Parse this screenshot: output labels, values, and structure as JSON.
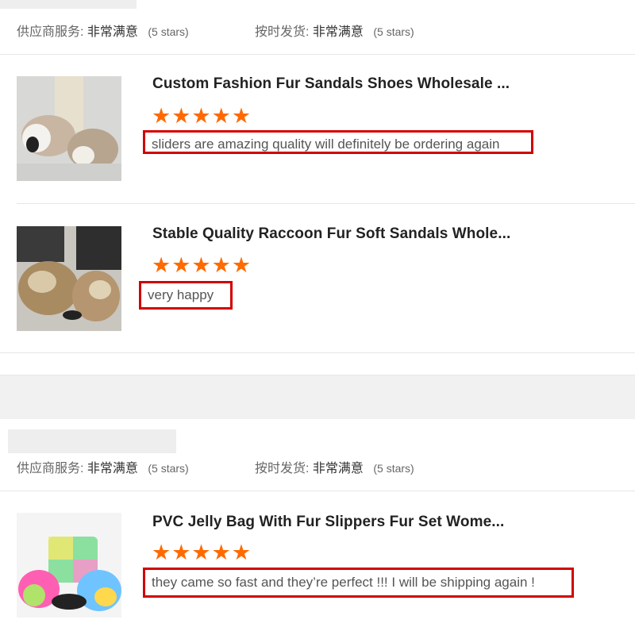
{
  "groups": [
    {
      "supplier_service_label": "供应商服务:",
      "supplier_service_value": "非常满意",
      "supplier_service_stars": "(5 stars)",
      "shipping_label": "按时发货:",
      "shipping_value": "非常满意",
      "shipping_stars": "(5 stars)"
    },
    {
      "supplier_service_label": "供应商服务:",
      "supplier_service_value": "非常满意",
      "supplier_service_stars": "(5 stars)",
      "shipping_label": "按时发货:",
      "shipping_value": "非常满意",
      "shipping_stars": "(5 stars)"
    }
  ],
  "reviews": [
    {
      "title": "Custom Fashion Fur Sandals Shoes Wholesale ...",
      "stars": "★★★★★",
      "rating": 5,
      "comment": "sliders are amazing quality will definitely be ordering again"
    },
    {
      "title": "Stable Quality Raccoon Fur Soft Sandals Whole...",
      "stars": "★★★★★",
      "rating": 5,
      "comment": "very happy"
    },
    {
      "title": "PVC Jelly Bag With Fur Slippers Fur Set Wome...",
      "stars": "★★★★★",
      "rating": 5,
      "comment": "they came so fast and they’re perfect !!! I will be shipping again !"
    }
  ],
  "colors": {
    "star": "#ff6a00",
    "highlight_box": "#d20000"
  }
}
